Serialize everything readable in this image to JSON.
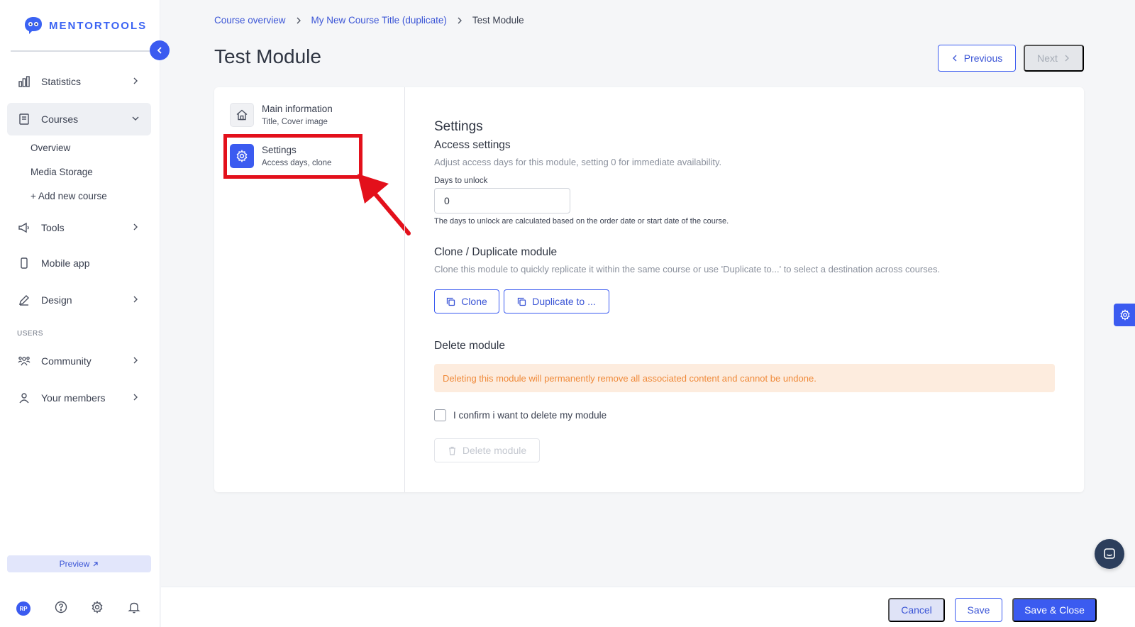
{
  "brand": {
    "name": "MENTORTOOLS",
    "accent": "#3b5bf0"
  },
  "sidebar": {
    "items": [
      {
        "label": "Statistics"
      },
      {
        "label": "Courses"
      },
      {
        "label": "Tools"
      },
      {
        "label": "Mobile app"
      },
      {
        "label": "Design"
      },
      {
        "label": "Community"
      },
      {
        "label": "Your members"
      }
    ],
    "courses_sub": [
      "Overview",
      "Media Storage",
      "+ Add new course"
    ],
    "section_users": "USERS",
    "preview_label": "Preview",
    "avatar_initials": "RP"
  },
  "header": {
    "breadcrumb": [
      "Course overview",
      "My New Course Title (duplicate)",
      "Test Module"
    ],
    "title": "Test Module",
    "previous_label": "Previous",
    "next_label": "Next"
  },
  "steps": [
    {
      "title": "Main information",
      "subtitle": "Title, Cover image",
      "icon": "home-icon"
    },
    {
      "title": "Settings",
      "subtitle": "Access days, clone",
      "icon": "gear-icon",
      "active": true
    }
  ],
  "settings": {
    "heading": "Settings",
    "access": {
      "heading": "Access settings",
      "description": "Adjust access days for this module, setting 0 for immediate availability.",
      "field_label": "Days to unlock",
      "field_value": "0",
      "hint": "The days to unlock are calculated based on the order date or start date of the course."
    },
    "clone": {
      "heading": "Clone / Duplicate module",
      "description": "Clone this module to quickly replicate it within the same course or use 'Duplicate to...' to select a destination across courses.",
      "clone_label": "Clone",
      "duplicate_label": "Duplicate to ..."
    },
    "delete": {
      "heading": "Delete module",
      "warning": "Deleting this module will permanently remove all associated content and cannot be undone.",
      "confirm_label": "I confirm i want to delete my module",
      "button_label": "Delete module"
    }
  },
  "footer": {
    "cancel_label": "Cancel",
    "save_label": "Save",
    "save_close_label": "Save & Close"
  },
  "colors": {
    "highlight": "#e3101b",
    "warning_bg": "#fdecde",
    "warning_text": "#ef8a3a"
  }
}
